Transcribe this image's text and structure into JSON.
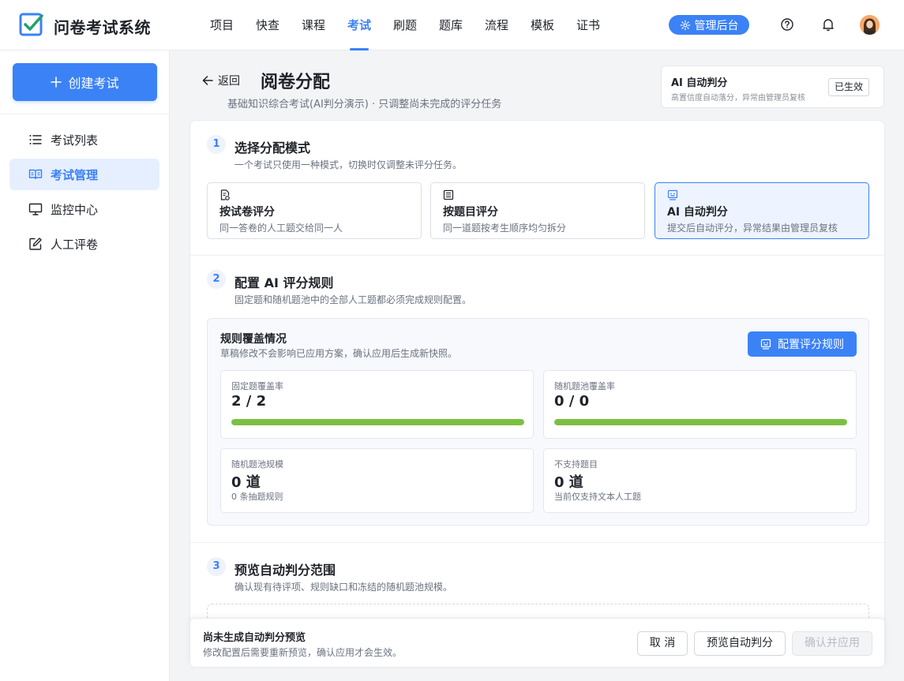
{
  "app": {
    "name": "问卷考试系统"
  },
  "nav": {
    "items": [
      "项目",
      "快查",
      "课程",
      "考试",
      "刷题",
      "题库",
      "流程",
      "模板",
      "证书"
    ],
    "active": "考试"
  },
  "header": {
    "admin_label": "管理后台"
  },
  "sidebar": {
    "create_label": "创建考试",
    "items": [
      {
        "label": "考试列表",
        "icon": "list-icon"
      },
      {
        "label": "考试管理",
        "icon": "book-open-icon",
        "active": true
      },
      {
        "label": "监控中心",
        "icon": "monitor-icon"
      },
      {
        "label": "人工评卷",
        "icon": "edit-icon"
      }
    ]
  },
  "page": {
    "back_label": "返回",
    "title": "阅卷分配",
    "subtitle": "基础知识综合考试(AI判分演示) · 只调整尚未完成的评分任务"
  },
  "ai_status": {
    "title": "AI 自动判分",
    "desc": "高置信度自动落分，异常由管理员复核",
    "badge": "已生效"
  },
  "step1": {
    "num": "1",
    "title": "选择分配模式",
    "sub": "一个考试只使用一种模式，切换时仅调整未评分任务。",
    "modes": [
      {
        "title": "按试卷评分",
        "desc": "同一答卷的人工题交给同一人",
        "icon": "paper-check-icon"
      },
      {
        "title": "按题目评分",
        "desc": "同一道题按考生顺序均匀拆分",
        "icon": "list-doc-icon"
      },
      {
        "title": "AI 自动判分",
        "desc": "提交后自动评分，异常结果由管理员复核",
        "icon": "robot-icon",
        "active": true
      }
    ]
  },
  "step2": {
    "num": "2",
    "title": "配置 AI 评分规则",
    "sub": "固定题和随机题池中的全部人工题都必须完成规则配置。",
    "coverage": {
      "title": "规则覆盖情况",
      "sub": "草稿修改不会影响已应用方案，确认应用后生成新快照。",
      "config_label": "配置评分规则",
      "stats": [
        {
          "label": "固定题覆盖率",
          "value": "2 / 2",
          "progress": 1.0
        },
        {
          "label": "随机题池覆盖率",
          "value": "0 / 0",
          "progress": 1.0
        },
        {
          "label": "随机题池规模",
          "value": "0 道",
          "note": "0 条抽题规则"
        },
        {
          "label": "不支持题目",
          "value": "0 道",
          "note": "当前仅支持文本人工题"
        }
      ]
    }
  },
  "step3": {
    "num": "3",
    "title": "预览自动判分范围",
    "sub": "确认现有待评项、规则缺口和冻结的随机题池规模。"
  },
  "footer": {
    "title": "尚未生成自动判分预览",
    "sub": "修改配置后需要重新预览，确认应用才会生效。",
    "cancel_label": "取 消",
    "preview_label": "预览自动判分",
    "confirm_label": "确认并应用"
  },
  "colors": {
    "primary": "#3b82f6",
    "success": "#7bc043",
    "active_bg": "#e6efff"
  }
}
